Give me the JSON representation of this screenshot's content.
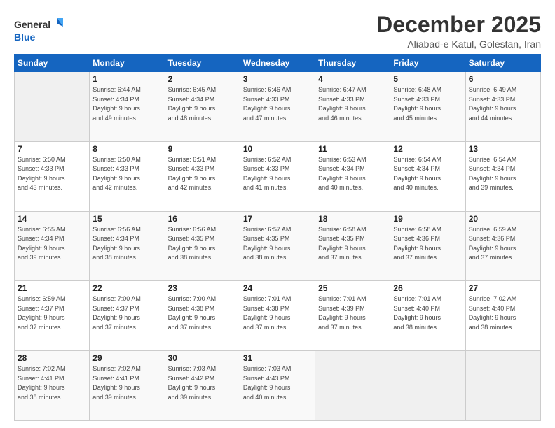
{
  "logo": {
    "line1": "General",
    "line2": "Blue"
  },
  "title": "December 2025",
  "location": "Aliabad-e Katul, Golestan, Iran",
  "days_header": [
    "Sunday",
    "Monday",
    "Tuesday",
    "Wednesday",
    "Thursday",
    "Friday",
    "Saturday"
  ],
  "weeks": [
    [
      {
        "day": "",
        "info": ""
      },
      {
        "day": "1",
        "info": "Sunrise: 6:44 AM\nSunset: 4:34 PM\nDaylight: 9 hours\nand 49 minutes."
      },
      {
        "day": "2",
        "info": "Sunrise: 6:45 AM\nSunset: 4:34 PM\nDaylight: 9 hours\nand 48 minutes."
      },
      {
        "day": "3",
        "info": "Sunrise: 6:46 AM\nSunset: 4:33 PM\nDaylight: 9 hours\nand 47 minutes."
      },
      {
        "day": "4",
        "info": "Sunrise: 6:47 AM\nSunset: 4:33 PM\nDaylight: 9 hours\nand 46 minutes."
      },
      {
        "day": "5",
        "info": "Sunrise: 6:48 AM\nSunset: 4:33 PM\nDaylight: 9 hours\nand 45 minutes."
      },
      {
        "day": "6",
        "info": "Sunrise: 6:49 AM\nSunset: 4:33 PM\nDaylight: 9 hours\nand 44 minutes."
      }
    ],
    [
      {
        "day": "7",
        "info": "Sunrise: 6:50 AM\nSunset: 4:33 PM\nDaylight: 9 hours\nand 43 minutes."
      },
      {
        "day": "8",
        "info": "Sunrise: 6:50 AM\nSunset: 4:33 PM\nDaylight: 9 hours\nand 42 minutes."
      },
      {
        "day": "9",
        "info": "Sunrise: 6:51 AM\nSunset: 4:33 PM\nDaylight: 9 hours\nand 42 minutes."
      },
      {
        "day": "10",
        "info": "Sunrise: 6:52 AM\nSunset: 4:33 PM\nDaylight: 9 hours\nand 41 minutes."
      },
      {
        "day": "11",
        "info": "Sunrise: 6:53 AM\nSunset: 4:34 PM\nDaylight: 9 hours\nand 40 minutes."
      },
      {
        "day": "12",
        "info": "Sunrise: 6:54 AM\nSunset: 4:34 PM\nDaylight: 9 hours\nand 40 minutes."
      },
      {
        "day": "13",
        "info": "Sunrise: 6:54 AM\nSunset: 4:34 PM\nDaylight: 9 hours\nand 39 minutes."
      }
    ],
    [
      {
        "day": "14",
        "info": "Sunrise: 6:55 AM\nSunset: 4:34 PM\nDaylight: 9 hours\nand 39 minutes."
      },
      {
        "day": "15",
        "info": "Sunrise: 6:56 AM\nSunset: 4:34 PM\nDaylight: 9 hours\nand 38 minutes."
      },
      {
        "day": "16",
        "info": "Sunrise: 6:56 AM\nSunset: 4:35 PM\nDaylight: 9 hours\nand 38 minutes."
      },
      {
        "day": "17",
        "info": "Sunrise: 6:57 AM\nSunset: 4:35 PM\nDaylight: 9 hours\nand 38 minutes."
      },
      {
        "day": "18",
        "info": "Sunrise: 6:58 AM\nSunset: 4:35 PM\nDaylight: 9 hours\nand 37 minutes."
      },
      {
        "day": "19",
        "info": "Sunrise: 6:58 AM\nSunset: 4:36 PM\nDaylight: 9 hours\nand 37 minutes."
      },
      {
        "day": "20",
        "info": "Sunrise: 6:59 AM\nSunset: 4:36 PM\nDaylight: 9 hours\nand 37 minutes."
      }
    ],
    [
      {
        "day": "21",
        "info": "Sunrise: 6:59 AM\nSunset: 4:37 PM\nDaylight: 9 hours\nand 37 minutes."
      },
      {
        "day": "22",
        "info": "Sunrise: 7:00 AM\nSunset: 4:37 PM\nDaylight: 9 hours\nand 37 minutes."
      },
      {
        "day": "23",
        "info": "Sunrise: 7:00 AM\nSunset: 4:38 PM\nDaylight: 9 hours\nand 37 minutes."
      },
      {
        "day": "24",
        "info": "Sunrise: 7:01 AM\nSunset: 4:38 PM\nDaylight: 9 hours\nand 37 minutes."
      },
      {
        "day": "25",
        "info": "Sunrise: 7:01 AM\nSunset: 4:39 PM\nDaylight: 9 hours\nand 37 minutes."
      },
      {
        "day": "26",
        "info": "Sunrise: 7:01 AM\nSunset: 4:40 PM\nDaylight: 9 hours\nand 38 minutes."
      },
      {
        "day": "27",
        "info": "Sunrise: 7:02 AM\nSunset: 4:40 PM\nDaylight: 9 hours\nand 38 minutes."
      }
    ],
    [
      {
        "day": "28",
        "info": "Sunrise: 7:02 AM\nSunset: 4:41 PM\nDaylight: 9 hours\nand 38 minutes."
      },
      {
        "day": "29",
        "info": "Sunrise: 7:02 AM\nSunset: 4:41 PM\nDaylight: 9 hours\nand 39 minutes."
      },
      {
        "day": "30",
        "info": "Sunrise: 7:03 AM\nSunset: 4:42 PM\nDaylight: 9 hours\nand 39 minutes."
      },
      {
        "day": "31",
        "info": "Sunrise: 7:03 AM\nSunset: 4:43 PM\nDaylight: 9 hours\nand 40 minutes."
      },
      {
        "day": "",
        "info": ""
      },
      {
        "day": "",
        "info": ""
      },
      {
        "day": "",
        "info": ""
      }
    ]
  ]
}
